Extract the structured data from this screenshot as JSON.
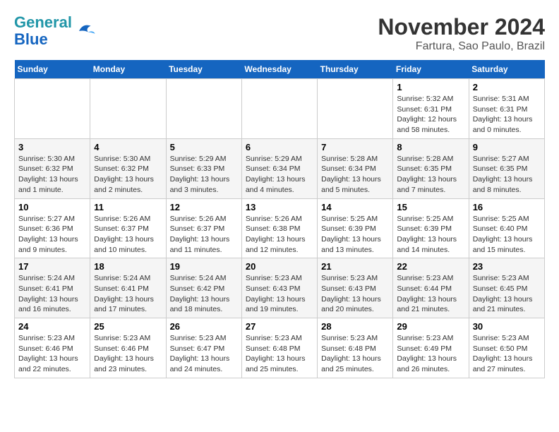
{
  "header": {
    "logo_line1": "General",
    "logo_line2": "Blue",
    "month": "November 2024",
    "location": "Fartura, Sao Paulo, Brazil"
  },
  "weekdays": [
    "Sunday",
    "Monday",
    "Tuesday",
    "Wednesday",
    "Thursday",
    "Friday",
    "Saturday"
  ],
  "weeks": [
    [
      {
        "day": "",
        "info": ""
      },
      {
        "day": "",
        "info": ""
      },
      {
        "day": "",
        "info": ""
      },
      {
        "day": "",
        "info": ""
      },
      {
        "day": "",
        "info": ""
      },
      {
        "day": "1",
        "info": "Sunrise: 5:32 AM\nSunset: 6:31 PM\nDaylight: 12 hours\nand 58 minutes."
      },
      {
        "day": "2",
        "info": "Sunrise: 5:31 AM\nSunset: 6:31 PM\nDaylight: 13 hours\nand 0 minutes."
      }
    ],
    [
      {
        "day": "3",
        "info": "Sunrise: 5:30 AM\nSunset: 6:32 PM\nDaylight: 13 hours\nand 1 minute."
      },
      {
        "day": "4",
        "info": "Sunrise: 5:30 AM\nSunset: 6:32 PM\nDaylight: 13 hours\nand 2 minutes."
      },
      {
        "day": "5",
        "info": "Sunrise: 5:29 AM\nSunset: 6:33 PM\nDaylight: 13 hours\nand 3 minutes."
      },
      {
        "day": "6",
        "info": "Sunrise: 5:29 AM\nSunset: 6:34 PM\nDaylight: 13 hours\nand 4 minutes."
      },
      {
        "day": "7",
        "info": "Sunrise: 5:28 AM\nSunset: 6:34 PM\nDaylight: 13 hours\nand 5 minutes."
      },
      {
        "day": "8",
        "info": "Sunrise: 5:28 AM\nSunset: 6:35 PM\nDaylight: 13 hours\nand 7 minutes."
      },
      {
        "day": "9",
        "info": "Sunrise: 5:27 AM\nSunset: 6:35 PM\nDaylight: 13 hours\nand 8 minutes."
      }
    ],
    [
      {
        "day": "10",
        "info": "Sunrise: 5:27 AM\nSunset: 6:36 PM\nDaylight: 13 hours\nand 9 minutes."
      },
      {
        "day": "11",
        "info": "Sunrise: 5:26 AM\nSunset: 6:37 PM\nDaylight: 13 hours\nand 10 minutes."
      },
      {
        "day": "12",
        "info": "Sunrise: 5:26 AM\nSunset: 6:37 PM\nDaylight: 13 hours\nand 11 minutes."
      },
      {
        "day": "13",
        "info": "Sunrise: 5:26 AM\nSunset: 6:38 PM\nDaylight: 13 hours\nand 12 minutes."
      },
      {
        "day": "14",
        "info": "Sunrise: 5:25 AM\nSunset: 6:39 PM\nDaylight: 13 hours\nand 13 minutes."
      },
      {
        "day": "15",
        "info": "Sunrise: 5:25 AM\nSunset: 6:39 PM\nDaylight: 13 hours\nand 14 minutes."
      },
      {
        "day": "16",
        "info": "Sunrise: 5:25 AM\nSunset: 6:40 PM\nDaylight: 13 hours\nand 15 minutes."
      }
    ],
    [
      {
        "day": "17",
        "info": "Sunrise: 5:24 AM\nSunset: 6:41 PM\nDaylight: 13 hours\nand 16 minutes."
      },
      {
        "day": "18",
        "info": "Sunrise: 5:24 AM\nSunset: 6:41 PM\nDaylight: 13 hours\nand 17 minutes."
      },
      {
        "day": "19",
        "info": "Sunrise: 5:24 AM\nSunset: 6:42 PM\nDaylight: 13 hours\nand 18 minutes."
      },
      {
        "day": "20",
        "info": "Sunrise: 5:23 AM\nSunset: 6:43 PM\nDaylight: 13 hours\nand 19 minutes."
      },
      {
        "day": "21",
        "info": "Sunrise: 5:23 AM\nSunset: 6:43 PM\nDaylight: 13 hours\nand 20 minutes."
      },
      {
        "day": "22",
        "info": "Sunrise: 5:23 AM\nSunset: 6:44 PM\nDaylight: 13 hours\nand 21 minutes."
      },
      {
        "day": "23",
        "info": "Sunrise: 5:23 AM\nSunset: 6:45 PM\nDaylight: 13 hours\nand 21 minutes."
      }
    ],
    [
      {
        "day": "24",
        "info": "Sunrise: 5:23 AM\nSunset: 6:46 PM\nDaylight: 13 hours\nand 22 minutes."
      },
      {
        "day": "25",
        "info": "Sunrise: 5:23 AM\nSunset: 6:46 PM\nDaylight: 13 hours\nand 23 minutes."
      },
      {
        "day": "26",
        "info": "Sunrise: 5:23 AM\nSunset: 6:47 PM\nDaylight: 13 hours\nand 24 minutes."
      },
      {
        "day": "27",
        "info": "Sunrise: 5:23 AM\nSunset: 6:48 PM\nDaylight: 13 hours\nand 25 minutes."
      },
      {
        "day": "28",
        "info": "Sunrise: 5:23 AM\nSunset: 6:48 PM\nDaylight: 13 hours\nand 25 minutes."
      },
      {
        "day": "29",
        "info": "Sunrise: 5:23 AM\nSunset: 6:49 PM\nDaylight: 13 hours\nand 26 minutes."
      },
      {
        "day": "30",
        "info": "Sunrise: 5:23 AM\nSunset: 6:50 PM\nDaylight: 13 hours\nand 27 minutes."
      }
    ]
  ]
}
